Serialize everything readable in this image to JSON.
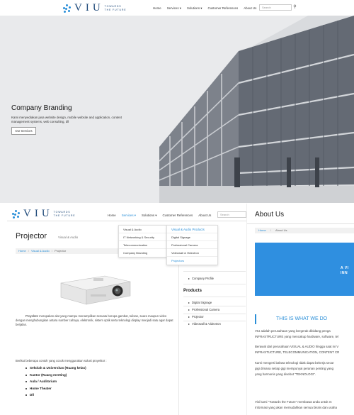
{
  "brand": {
    "name": "VIU",
    "tagline_line1": "TOWARDS",
    "tagline_line2": "THE FUTURE",
    "accent": "#2a8fd8"
  },
  "nav": {
    "items": [
      "Home",
      "Services ▾",
      "Solutions ▾",
      "Customer References",
      "About Us"
    ],
    "search_placeholder": "Search",
    "search_icon": "magnifier-icon"
  },
  "hero": {
    "title": "Company Branding",
    "text": "Kami menyediakan jasa website design, mobile website and application, content management systems, web consulting, dll",
    "button": "Our Services"
  },
  "projector_page": {
    "title": "Projector",
    "subtitle": "Visual & Audio",
    "breadcrumb": [
      "Home",
      "/",
      "Visual & Audio",
      "/",
      "Projector"
    ],
    "paragraph_lead": "Proyektor",
    "paragraph": "merupakan alat yang mampu menampilkan sesuatu berupa gambar, tulisan, suara maupun video dengan menghubungkan antara sumber cahaya, elektronik, sistem optik serta teknologi display menjadi satu agar dapat berjalan.",
    "list_intro": "Berikut beberapa contoh yang cocok menggunakan solusi proyektor :",
    "list": [
      "Sekolah & Universitas (Ruang kelas)",
      "Kantor (Ruang meeting)",
      "Aula / Auditorium",
      "Home Theater",
      "Dll"
    ]
  },
  "services_menu": [
    "Visual & Audio",
    "IT Networking & Security",
    "Telecommunication",
    "Company Branding"
  ],
  "visual_audio_menu": {
    "header": "Visual & Audio Products",
    "items": [
      "Digital Signage",
      "Professional Camera",
      "Videowall & Videotron",
      "Projectors"
    ]
  },
  "sidebar": {
    "company_profile": "Company Profile",
    "products_title": "Products",
    "products": [
      "Digital Signage",
      "Professional Camera",
      "Projector",
      "Videowall & Videotron"
    ]
  },
  "about_page": {
    "title": "About Us",
    "breadcrumb_home": "Home",
    "breadcrumb_current": "About Us",
    "banner_line1": "A VI",
    "banner_line2": "INN",
    "section_title": "THIS IS WHAT WE DO",
    "p1_line1": "VIU adalah perusahaan yang bergerak dibidang penga",
    "p1_line2": "INFRASTRUCTURE yang mencakup hardware, software, tel",
    "p2_line1": "Berawal dari perusahaan VISUAL & AUDIO hingga saat ini V",
    "p2_line2": "INFRASTUCTURE, TELECOMMUNICATION, CONTENT CR",
    "p3_line1": "Kami mengerti bahwa teknologi tidak dapat bekerja secar",
    "p3_line2": "gigi dimana setiap gigi mempunyai peranan penting yang",
    "p3_line3": "yang harmonis yang disebut “TEKNOLOGI”.",
    "p4_line1": "Visi kami “Towards the Future” membawa anda untuk m",
    "p4_line2": "Informasi yang akan memudahkan semua bisnis dan usaha"
  }
}
